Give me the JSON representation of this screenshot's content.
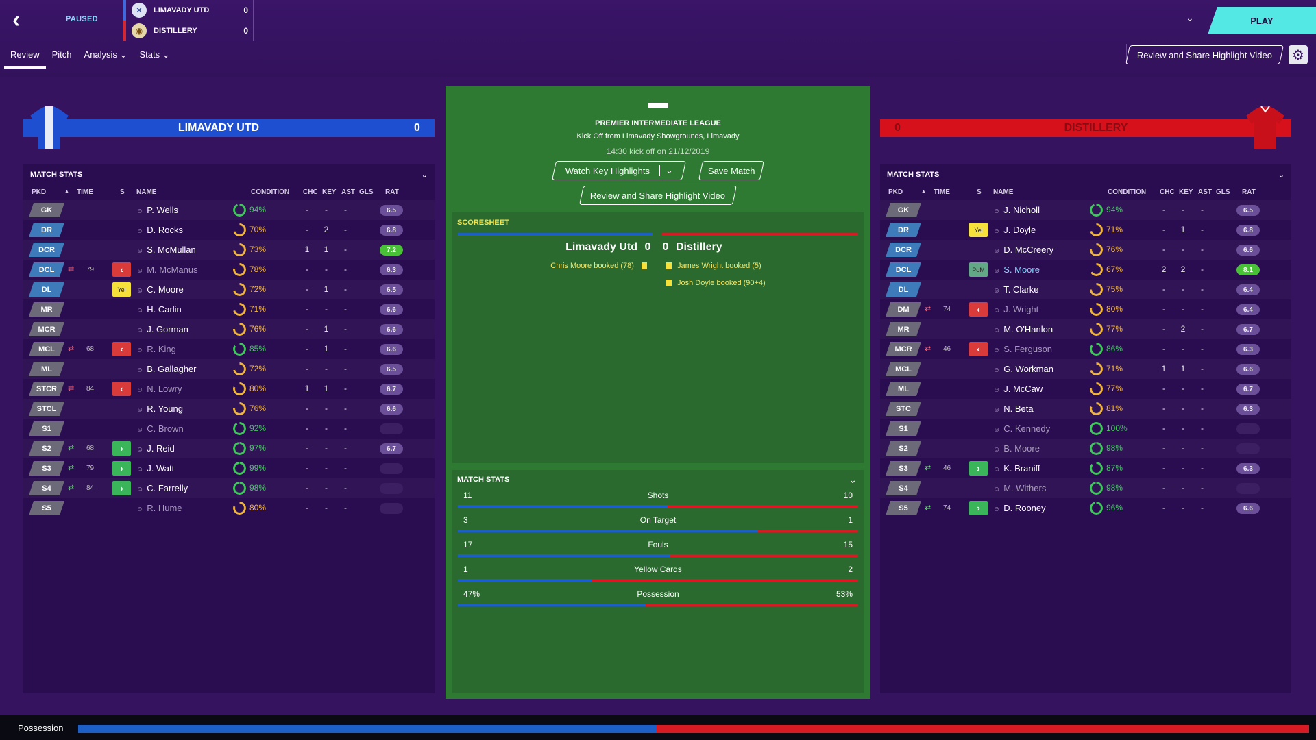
{
  "topbar": {
    "status": "PAUSED",
    "home": {
      "name": "LIMAVADY UTD",
      "score": "0",
      "color": "#3c6be0"
    },
    "away": {
      "name": "DISTILLERY",
      "score": "0",
      "color": "#d7262e"
    },
    "tabs": [
      "Review",
      "Pitch",
      "Analysis ⌄",
      "Stats ⌄"
    ],
    "active_tab": "Review",
    "play_label": "PLAY",
    "share_label": "Review and Share Highlight Video"
  },
  "home_team": {
    "name": "LIMAVADY UTD",
    "score": "0",
    "color": "#1f4fd1",
    "panel_title": "MATCH STATS",
    "columns": [
      "PKD",
      "TIME",
      "S",
      "NAME",
      "CONDITION",
      "CHC",
      "KEY",
      "AST",
      "GLS",
      "RAT"
    ],
    "players": [
      {
        "pos": "GK",
        "name": "P. Wells",
        "cond": "94%",
        "chc": "-",
        "key": "-",
        "ast": "-",
        "rat": "6.5",
        "ct": "g"
      },
      {
        "pos": "DR",
        "name": "D. Rocks",
        "cond": "70%",
        "chc": "-",
        "key": "2",
        "ast": "-",
        "rat": "6.8",
        "ct": "y"
      },
      {
        "pos": "DCR",
        "name": "S. McMullan",
        "cond": "73%",
        "chc": "1",
        "key": "1",
        "ast": "-",
        "rat": "7.2",
        "ct": "y",
        "hi": true
      },
      {
        "pos": "DCL",
        "time": "79",
        "sub": "out",
        "name": "M. McManus",
        "cond": "78%",
        "chc": "-",
        "key": "-",
        "ast": "-",
        "rat": "6.3",
        "ct": "y",
        "dim": true
      },
      {
        "pos": "DL",
        "card": "Yel",
        "name": "C. Moore",
        "cond": "72%",
        "chc": "-",
        "key": "1",
        "ast": "-",
        "rat": "6.5",
        "ct": "y"
      },
      {
        "pos": "MR",
        "name": "H. Carlin",
        "cond": "71%",
        "chc": "-",
        "key": "-",
        "ast": "-",
        "rat": "6.6",
        "ct": "y"
      },
      {
        "pos": "MCR",
        "name": "J. Gorman",
        "cond": "76%",
        "chc": "-",
        "key": "1",
        "ast": "-",
        "rat": "6.6",
        "ct": "y"
      },
      {
        "pos": "MCL",
        "time": "68",
        "sub": "out",
        "name": "R. King",
        "cond": "85%",
        "chc": "-",
        "key": "1",
        "ast": "-",
        "rat": "6.6",
        "ct": "g",
        "dim": true
      },
      {
        "pos": "ML",
        "name": "B. Gallagher",
        "cond": "72%",
        "chc": "-",
        "key": "-",
        "ast": "-",
        "rat": "6.5",
        "ct": "y"
      },
      {
        "pos": "STCR",
        "time": "84",
        "sub": "out",
        "name": "N. Lowry",
        "cond": "80%",
        "chc": "1",
        "key": "1",
        "ast": "-",
        "rat": "6.7",
        "ct": "y",
        "dim": true
      },
      {
        "pos": "STCL",
        "name": "R. Young",
        "cond": "76%",
        "chc": "-",
        "key": "-",
        "ast": "-",
        "rat": "6.6",
        "ct": "y"
      },
      {
        "pos": "S1",
        "name": "C. Brown",
        "cond": "92%",
        "chc": "-",
        "key": "-",
        "ast": "-",
        "rat": "",
        "ct": "g",
        "dim": true
      },
      {
        "pos": "S2",
        "time": "68",
        "sub": "in",
        "name": "J. Reid",
        "cond": "97%",
        "chc": "-",
        "key": "-",
        "ast": "-",
        "rat": "6.7",
        "ct": "g"
      },
      {
        "pos": "S3",
        "time": "79",
        "sub": "in",
        "name": "J. Watt",
        "cond": "99%",
        "chc": "-",
        "key": "-",
        "ast": "-",
        "rat": "",
        "ct": "g"
      },
      {
        "pos": "S4",
        "time": "84",
        "sub": "in",
        "name": "C. Farrelly",
        "cond": "98%",
        "chc": "-",
        "key": "-",
        "ast": "-",
        "rat": "",
        "ct": "g"
      },
      {
        "pos": "S5",
        "name": "R. Hume",
        "cond": "80%",
        "chc": "-",
        "key": "-",
        "ast": "-",
        "rat": "",
        "ct": "y",
        "dim": true
      }
    ]
  },
  "away_team": {
    "name": "DISTILLERY",
    "score": "0",
    "color": "#d7111c",
    "panel_title": "MATCH STATS",
    "columns": [
      "PKD",
      "TIME",
      "S",
      "NAME",
      "CONDITION",
      "CHC",
      "KEY",
      "AST",
      "GLS",
      "RAT"
    ],
    "players": [
      {
        "pos": "GK",
        "name": "J. Nicholl",
        "cond": "94%",
        "chc": "-",
        "key": "-",
        "ast": "-",
        "rat": "6.5",
        "ct": "g"
      },
      {
        "pos": "DR",
        "card": "Yel",
        "name": "J. Doyle",
        "cond": "71%",
        "chc": "-",
        "key": "1",
        "ast": "-",
        "rat": "6.8",
        "ct": "y"
      },
      {
        "pos": "DCR",
        "name": "D. McCreery",
        "cond": "76%",
        "chc": "-",
        "key": "-",
        "ast": "-",
        "rat": "6.6",
        "ct": "y"
      },
      {
        "pos": "DCL",
        "card": "PoM",
        "name": "S. Moore",
        "cond": "67%",
        "chc": "2",
        "key": "2",
        "ast": "-",
        "rat": "8.1",
        "ct": "y",
        "hi": true,
        "hl": true
      },
      {
        "pos": "DL",
        "name": "T. Clarke",
        "cond": "75%",
        "chc": "-",
        "key": "-",
        "ast": "-",
        "rat": "6.4",
        "ct": "y"
      },
      {
        "pos": "DM",
        "time": "74",
        "sub": "out",
        "name": "J. Wright",
        "cond": "80%",
        "chc": "-",
        "key": "-",
        "ast": "-",
        "rat": "6.4",
        "ct": "y",
        "dim": true
      },
      {
        "pos": "MR",
        "name": "M. O'Hanlon",
        "cond": "77%",
        "chc": "-",
        "key": "2",
        "ast": "-",
        "rat": "6.7",
        "ct": "y"
      },
      {
        "pos": "MCR",
        "time": "46",
        "sub": "out",
        "name": "S. Ferguson",
        "cond": "86%",
        "chc": "-",
        "key": "-",
        "ast": "-",
        "rat": "6.3",
        "ct": "g",
        "dim": true
      },
      {
        "pos": "MCL",
        "name": "G. Workman",
        "cond": "71%",
        "chc": "1",
        "key": "1",
        "ast": "-",
        "rat": "6.6",
        "ct": "y"
      },
      {
        "pos": "ML",
        "name": "J. McCaw",
        "cond": "77%",
        "chc": "-",
        "key": "-",
        "ast": "-",
        "rat": "6.7",
        "ct": "y"
      },
      {
        "pos": "STC",
        "name": "N. Beta",
        "cond": "81%",
        "chc": "-",
        "key": "-",
        "ast": "-",
        "rat": "6.3",
        "ct": "y"
      },
      {
        "pos": "S1",
        "name": "C. Kennedy",
        "cond": "100%",
        "chc": "-",
        "key": "-",
        "ast": "-",
        "rat": "",
        "ct": "g",
        "dim": true
      },
      {
        "pos": "S2",
        "name": "B. Moore",
        "cond": "98%",
        "chc": "-",
        "key": "-",
        "ast": "-",
        "rat": "",
        "ct": "g",
        "dim": true
      },
      {
        "pos": "S3",
        "time": "46",
        "sub": "in",
        "name": "K. Braniff",
        "cond": "87%",
        "chc": "-",
        "key": "-",
        "ast": "-",
        "rat": "6.3",
        "ct": "g"
      },
      {
        "pos": "S4",
        "name": "M. Withers",
        "cond": "98%",
        "chc": "-",
        "key": "-",
        "ast": "-",
        "rat": "",
        "ct": "g",
        "dim": true
      },
      {
        "pos": "S5",
        "time": "74",
        "sub": "in",
        "name": "D. Rooney",
        "cond": "96%",
        "chc": "-",
        "key": "-",
        "ast": "-",
        "rat": "6.6",
        "ct": "g"
      }
    ]
  },
  "center": {
    "competition": "PREMIER INTERMEDIATE LEAGUE",
    "venue": "Kick Off from Limavady Showgrounds, Limavady",
    "kickoff": "14:30 kick off on 21/12/2019",
    "watch_label": "Watch Key Highlights",
    "save_label": "Save Match",
    "share_label": "Review and Share Highlight Video",
    "scoresheet_title": "SCORESHEET",
    "home_name": "Limavady Utd",
    "home_score": "0",
    "away_name": "Distillery",
    "away_score": "0",
    "home_events": [
      "Chris Moore booked (78)"
    ],
    "away_events": [
      "James Wright booked (5)",
      "Josh Doyle booked (90+4)"
    ],
    "stats_title": "MATCH STATS",
    "stats": [
      {
        "label": "Shots",
        "home": "11",
        "away": "10",
        "hv": 11,
        "av": 10
      },
      {
        "label": "On Target",
        "home": "3",
        "away": "1",
        "hv": 3,
        "av": 1
      },
      {
        "label": "Fouls",
        "home": "17",
        "away": "15",
        "hv": 17,
        "av": 15
      },
      {
        "label": "Yellow Cards",
        "home": "1",
        "away": "2",
        "hv": 1,
        "av": 2
      },
      {
        "label": "Possession",
        "home": "47%",
        "away": "53%",
        "hv": 47,
        "av": 53
      }
    ]
  },
  "possession_bar": {
    "label": "Possession",
    "home": 47,
    "away": 53
  }
}
